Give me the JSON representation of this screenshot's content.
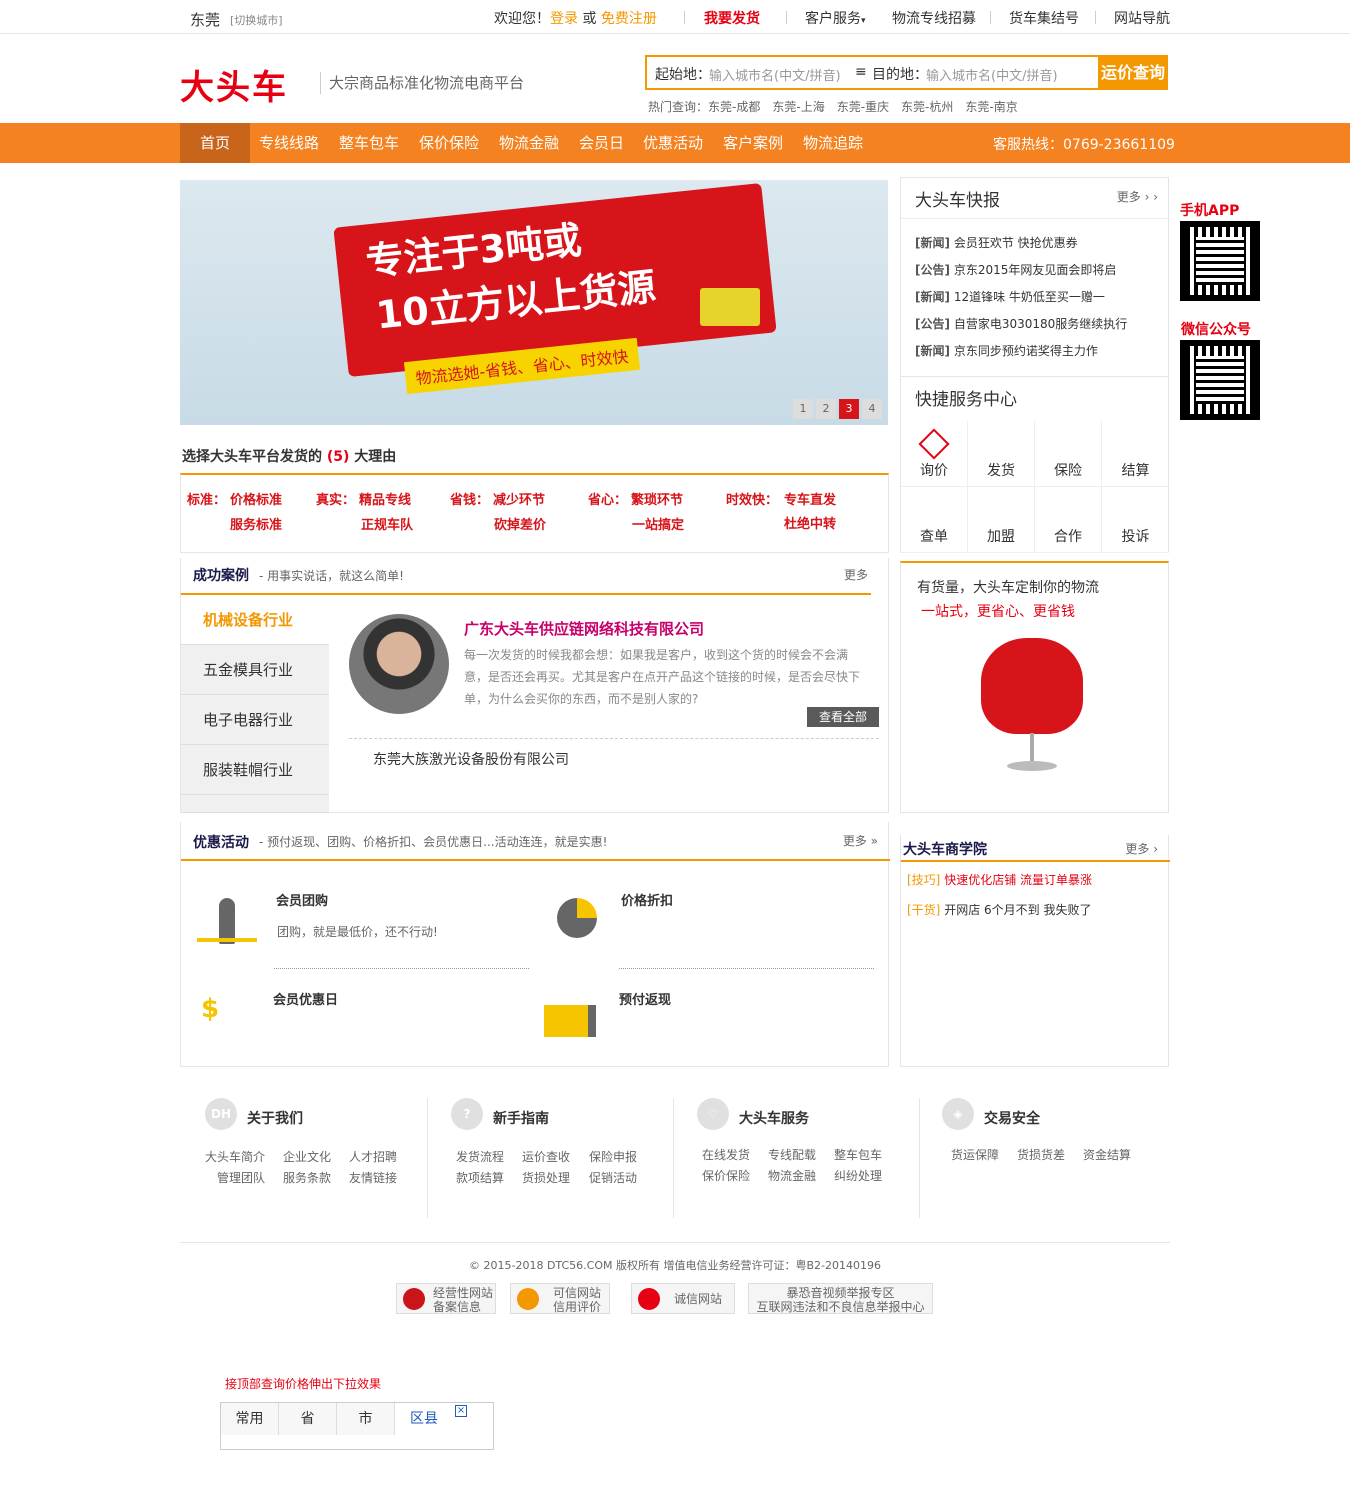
{
  "topbar": {
    "city": "东莞",
    "switch_city": "[切换城市]",
    "welcome": "欢迎您！",
    "login": "登录",
    "or": "或",
    "register": "免费注册",
    "ship": "我要发货",
    "service": "客户服务",
    "recruit": "物流专线招募",
    "truck_number": "货车集结号",
    "site_nav": "网站导航"
  },
  "header": {
    "logo_text": "大头车",
    "slogan": "大宗商品标准化物流电商平台",
    "search": {
      "from_label": "起始地：",
      "from_placeholder": "输入城市名(中文/拼音)",
      "to_label": "目的地：",
      "to_placeholder": "输入城市名(中文/拼音)",
      "button": "运价查询"
    },
    "hot_label": "热门查询：",
    "hot_routes": [
      "东莞-成都",
      "东莞-上海",
      "东莞-重庆",
      "东莞-杭州",
      "东莞-南京"
    ]
  },
  "nav": {
    "items": [
      "首页",
      "专线线路",
      "整车包车",
      "保价保险",
      "物流金融",
      "会员日",
      "优惠活动",
      "客户案例",
      "物流追踪"
    ],
    "hotline": "客服热线：0769-23661109"
  },
  "banner": {
    "line1": "专注于3吨或",
    "line2": "10立方以上货源",
    "line3": "物流选她-省钱、省心、时效快",
    "pages": [
      "1",
      "2",
      "3",
      "4"
    ],
    "active_page": "3"
  },
  "news": {
    "title": "大头车快报",
    "more": "更多 › ›",
    "items": [
      {
        "tag": "[新闻]",
        "text": "会员狂欢节 快抢优惠券"
      },
      {
        "tag": "[公告]",
        "text": "京东2015年网友见面会即将启"
      },
      {
        "tag": "[新闻]",
        "text": "12道锋味 牛奶低至买一赠一"
      },
      {
        "tag": "[公告]",
        "text": "自营家电3030180服务继续执行"
      },
      {
        "tag": "[新闻]",
        "text": "京东同步预约诺奖得主力作"
      }
    ]
  },
  "service_center": {
    "title": "快捷服务中心",
    "items": [
      "询价",
      "发货",
      "保险",
      "结算",
      "查单",
      "加盟",
      "合作",
      "投诉"
    ]
  },
  "sidebar_qr": {
    "app_label": "手机APP",
    "wechat_label": "微信公众号"
  },
  "reasons": {
    "title_prefix": "选择大头车平台发货的",
    "count": "(5)",
    "title_suffix": "大理由",
    "items": [
      {
        "label": "标准：",
        "l1": "价格标准",
        "l2": "服务标准"
      },
      {
        "label": "真实：",
        "l1": "精品专线",
        "l2": "正规车队"
      },
      {
        "label": "省钱：",
        "l1": "减少环节",
        "l2": "砍掉差价"
      },
      {
        "label": "省心：",
        "l1": "繁琐环节",
        "l2": "一站搞定"
      },
      {
        "label": "时效快：",
        "l1": "专车直发",
        "l2": "杜绝中转"
      }
    ]
  },
  "cases": {
    "title": "成功案例",
    "subtitle": "- 用事实说话，就这么简单!",
    "more": "更多",
    "tabs": [
      "机械设备行业",
      "五金模具行业",
      "电子电器行业",
      "服装鞋帽行业"
    ],
    "company": "广东大头车供应链网络科技有限公司",
    "description": "每一次发货的时候我都会想：如果我是客户，收到这个货的时候会不会满意，是否还会再买。尤其是客户在点开产品这个链接的时候，是否会尽快下单，为什么会买你的东西，而不是别人家的?",
    "view_all": "查看全部",
    "other_company": "东莞大族激光设备股份有限公司"
  },
  "chair_ad": {
    "line1": "有货量，大头车定制你的物流",
    "line2": "一站式，更省心、更省钱"
  },
  "promotions": {
    "title": "优惠活动",
    "subtitle": "- 预付返现、团购、价格折扣、会员优惠日...活动连连，就是实惠!",
    "more": "更多 »",
    "items": [
      {
        "title": "会员团购",
        "desc": "团购，就是最低价，还不行动!"
      },
      {
        "title": "价格折扣",
        "desc": ""
      },
      {
        "title": "会员优惠日",
        "desc": ""
      },
      {
        "title": "预付返现",
        "desc": ""
      }
    ]
  },
  "academy": {
    "title": "大头车商学院",
    "more": "更多 ›",
    "items": [
      {
        "tag": "[技巧]",
        "text": "快速优化店铺 流量订单暴涨"
      },
      {
        "tag": "[干货]",
        "text": "开网店 6个月不到 我失败了"
      }
    ]
  },
  "footer": {
    "cols": [
      {
        "icon": "DH",
        "title": "关于我们",
        "links": [
          "大头车简介",
          "企业文化",
          "人才招聘",
          "管理团队",
          "服务条款",
          "友情链接"
        ]
      },
      {
        "icon": "?",
        "title": "新手指南",
        "links": [
          "发货流程",
          "运价查收",
          "保险申报",
          "款项结算",
          "货损处理",
          "促销活动"
        ]
      },
      {
        "icon": "♡",
        "title": "大头车服务",
        "links": [
          "在线发货",
          "专线配载",
          "整车包车",
          "保价保险",
          "物流金融",
          "纠纷处理"
        ]
      },
      {
        "icon": "◈",
        "title": "交易安全",
        "links": [
          "货运保障",
          "货损货差",
          "资金结算"
        ]
      }
    ],
    "copyright": "© 2015-2018 DTC56.COM 版权所有 增值电信业务经营许可证：粤B2-20140196",
    "badges": [
      {
        "l1": "经营性网站",
        "l2": "备案信息"
      },
      {
        "l1": "可信网站",
        "l2": "信用评价"
      },
      {
        "l1": "诚信网站",
        "l2": ""
      },
      {
        "l1": "暴恐音视频举报专区",
        "l2": "互联网违法和不良信息举报中心"
      }
    ]
  },
  "dropdown_demo": {
    "note": "接顶部查询价格伸出下拉效果",
    "tabs": [
      "常用",
      "省",
      "市",
      "区县"
    ],
    "close": "×"
  },
  "colors": {
    "accent": "#f58220",
    "brand_red": "#e60012",
    "nav_active": "#c9641b"
  }
}
